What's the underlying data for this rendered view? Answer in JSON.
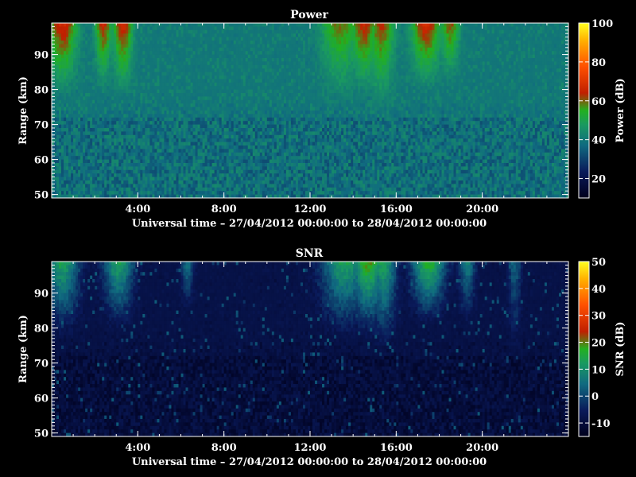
{
  "chart_data": [
    {
      "type": "heatmap",
      "title": "Power",
      "xlabel": "Universal time – 27/04/2012 00:00:00 to 28/04/2012 00:00:00",
      "ylabel": "Range (km)",
      "colorbar_label": "Power (dB)",
      "x_ticks": [
        "4:00",
        "8:00",
        "12:00",
        "16:00",
        "20:00"
      ],
      "y_ticks": [
        50,
        60,
        70,
        80,
        90
      ],
      "xlim_hours": [
        0,
        24
      ],
      "ylim_km": [
        49,
        99
      ],
      "clim": [
        10,
        100
      ],
      "colorbar_ticks": [
        20,
        40,
        60,
        80,
        100
      ],
      "description_of_field": {
        "background_db": 38,
        "enhancement_events": [
          {
            "center_hour": 0.5,
            "width_hours": 0.9,
            "peak_db": 68,
            "bottom_km": 80
          },
          {
            "center_hour": 2.4,
            "width_hours": 0.5,
            "peak_db": 66,
            "bottom_km": 82
          },
          {
            "center_hour": 3.3,
            "width_hours": 0.6,
            "peak_db": 68,
            "bottom_km": 80
          },
          {
            "center_hour": 13.4,
            "width_hours": 1.2,
            "peak_db": 60,
            "bottom_km": 78
          },
          {
            "center_hour": 14.5,
            "width_hours": 0.8,
            "peak_db": 66,
            "bottom_km": 80
          },
          {
            "center_hour": 15.3,
            "width_hours": 0.8,
            "peak_db": 64,
            "bottom_km": 76
          },
          {
            "center_hour": 17.4,
            "width_hours": 0.9,
            "peak_db": 68,
            "bottom_km": 82
          },
          {
            "center_hour": 18.5,
            "width_hours": 0.6,
            "peak_db": 62,
            "bottom_km": 84
          }
        ]
      }
    },
    {
      "type": "heatmap",
      "title": "SNR",
      "xlabel": "Universal time – 27/04/2012 00:00:00 to 28/04/2012 00:00:00",
      "ylabel": "Range (km)",
      "colorbar_label": "SNR (dB)",
      "x_ticks": [
        "4:00",
        "8:00",
        "12:00",
        "16:00",
        "20:00"
      ],
      "y_ticks": [
        50,
        60,
        70,
        80,
        90
      ],
      "xlim_hours": [
        0,
        24
      ],
      "ylim_km": [
        49,
        99
      ],
      "clim": [
        -15,
        50
      ],
      "colorbar_ticks": [
        -10,
        0,
        10,
        20,
        30,
        40,
        50
      ],
      "description_of_field": {
        "background_db": -10,
        "enhancement_events": [
          {
            "center_hour": 0.5,
            "width_hours": 1.0,
            "peak_db": 14,
            "bottom_km": 80
          },
          {
            "center_hour": 3.1,
            "width_hours": 0.9,
            "peak_db": 14,
            "bottom_km": 82
          },
          {
            "center_hour": 6.3,
            "width_hours": 0.4,
            "peak_db": 6,
            "bottom_km": 88
          },
          {
            "center_hour": 13.6,
            "width_hours": 1.4,
            "peak_db": 14,
            "bottom_km": 80
          },
          {
            "center_hour": 14.7,
            "width_hours": 1.0,
            "peak_db": 20,
            "bottom_km": 80
          },
          {
            "center_hour": 15.4,
            "width_hours": 0.8,
            "peak_db": 14,
            "bottom_km": 76
          },
          {
            "center_hour": 17.5,
            "width_hours": 1.0,
            "peak_db": 18,
            "bottom_km": 84
          },
          {
            "center_hour": 19.3,
            "width_hours": 0.5,
            "peak_db": 8,
            "bottom_km": 84
          },
          {
            "center_hour": 21.5,
            "width_hours": 0.4,
            "peak_db": 4,
            "bottom_km": 76
          }
        ]
      }
    }
  ]
}
